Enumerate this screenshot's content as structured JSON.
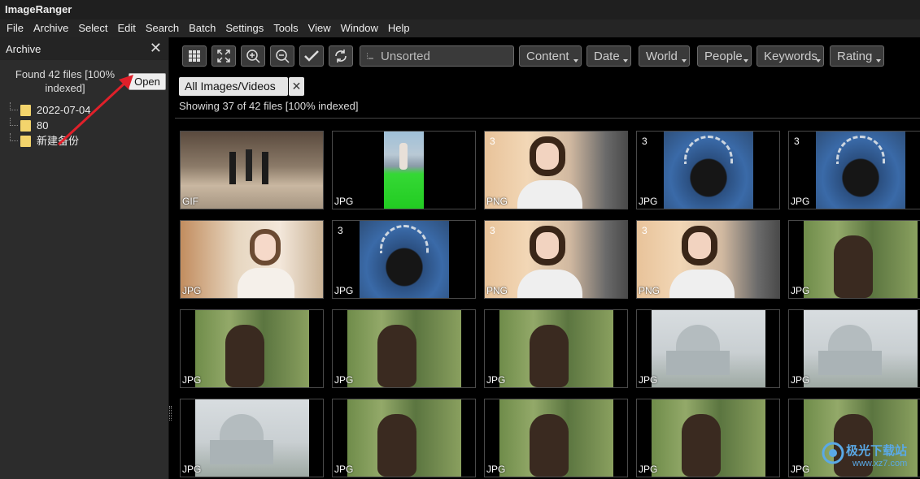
{
  "app": {
    "title": "ImageRanger"
  },
  "menu": [
    "File",
    "Archive",
    "Select",
    "Edit",
    "Search",
    "Batch",
    "Settings",
    "Tools",
    "View",
    "Window",
    "Help"
  ],
  "sidebar": {
    "title": "Archive",
    "close": "✕",
    "found_text": "Found 42 files [100% indexed]",
    "open_label": "Open",
    "folders": [
      "2022-07-04",
      "80",
      "新建备份"
    ]
  },
  "toolbar": {
    "icons": [
      "grid-view-icon",
      "fit-icon",
      "zoom-in-icon",
      "zoom-out-icon",
      "check-icon",
      "refresh-icon"
    ],
    "sort_label": "Unsorted",
    "dropdowns": [
      "Content",
      "Date",
      "World",
      "People",
      "Keywords",
      "Rating"
    ]
  },
  "filter": {
    "chip_label": "All Images/Videos",
    "chip_close": "✕"
  },
  "status": {
    "showing": "Showing 37 of 42 files [100% indexed]"
  },
  "thumbnails": [
    {
      "format": "GIF",
      "count": "",
      "kind": "dance"
    },
    {
      "format": "JPG",
      "count": "",
      "kind": "green"
    },
    {
      "format": "PNG",
      "count": "3",
      "kind": "girl"
    },
    {
      "format": "JPG",
      "count": "3",
      "kind": "man-blue"
    },
    {
      "format": "JPG",
      "count": "3",
      "kind": "man-blue"
    },
    {
      "format": "JPG",
      "count": "",
      "kind": "girl2"
    },
    {
      "format": "JPG",
      "count": "3",
      "kind": "man-blue"
    },
    {
      "format": "PNG",
      "count": "3",
      "kind": "girl"
    },
    {
      "format": "PNG",
      "count": "3",
      "kind": "girl"
    },
    {
      "format": "JPG",
      "count": "",
      "kind": "man-green"
    },
    {
      "format": "JPG",
      "count": "",
      "kind": "man-green"
    },
    {
      "format": "JPG",
      "count": "",
      "kind": "man-green"
    },
    {
      "format": "JPG",
      "count": "",
      "kind": "man-green"
    },
    {
      "format": "JPG",
      "count": "",
      "kind": "capitol"
    },
    {
      "format": "JPG",
      "count": "",
      "kind": "capitol"
    },
    {
      "format": "JPG",
      "count": "",
      "kind": "capitol"
    },
    {
      "format": "JPG",
      "count": "",
      "kind": "man-green"
    },
    {
      "format": "JPG",
      "count": "",
      "kind": "man-green"
    },
    {
      "format": "JPG",
      "count": "",
      "kind": "man-green"
    },
    {
      "format": "JPG",
      "count": "",
      "kind": "man-green"
    }
  ],
  "colors": {
    "folder": "#f3d46c",
    "arrow": "#e0202a",
    "watermark": "#5aa9e6"
  }
}
